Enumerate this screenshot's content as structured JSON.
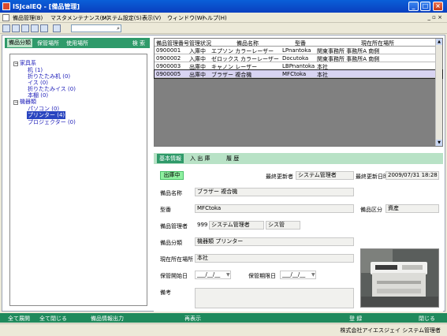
{
  "window": {
    "title": "ISJcalEQ - [備品管理]",
    "min": "_",
    "max": "□",
    "close": "×"
  },
  "menu": {
    "items": [
      "備品管理(B)",
      "マスタメンテナンス(M)",
      "システム設定(S)",
      "表示(V)",
      "ウィンドウ(W)",
      "ヘルプ(H)"
    ],
    "right": "_ ▫ ×"
  },
  "left_tabs": {
    "tabs": [
      "備品分類",
      "保管場所",
      "使用場所"
    ],
    "search": "検 索"
  },
  "tree": [
    {
      "label": "家具系",
      "box": "−"
    },
    {
      "label": "机 (1)"
    },
    {
      "label": "折りたたみ机 (0)"
    },
    {
      "label": "イス (0)"
    },
    {
      "label": "折りたたみイス (0)"
    },
    {
      "label": "本棚 (0)"
    },
    {
      "label": "機器類",
      "box": "−"
    },
    {
      "label": "パソコン (0)"
    },
    {
      "label": "プリンター (4)"
    },
    {
      "label": "プロジェクター (0)"
    }
  ],
  "grid": {
    "headers": [
      "備品管理番号",
      "管理状況",
      "備品名称",
      "型番",
      "現在所在場所"
    ],
    "rows": [
      [
        "0900001",
        "入庫中",
        "エプソン カラーレーザー",
        "LPnantoka",
        "関東事務所 事務所A 南側"
      ],
      [
        "0900002",
        "入庫中",
        "ゼロックス カラーレーザー",
        "Docutoka",
        "関東事務所 事務所A 南側"
      ],
      [
        "0900003",
        "出庫中",
        "キャノン レーザー",
        "LBPnantoka",
        "本社"
      ],
      [
        "0900005",
        "出庫中",
        "ブラザー 複合機",
        "MFCtoka",
        "本社"
      ]
    ]
  },
  "detail_tabs": [
    "基本情報",
    "入 出 庫",
    "履 歴"
  ],
  "detail": {
    "status": "出庫中",
    "last_updater_label": "最終更新者",
    "last_updater": "システム管理者",
    "last_updated_label": "最終更新日時",
    "last_updated": "2009/07/31 18:28",
    "name_label": "備品名称",
    "name": "ブラザー 複合機",
    "model_label": "型番",
    "model": "MFCtoka",
    "category_label": "備品区分",
    "category": "資産",
    "manager_label": "備品管理者",
    "manager_code": "999",
    "manager_name": "システム管理者",
    "manager_dept": "シス管",
    "class_label": "備品分類",
    "class": "機器類 プリンター",
    "location_label": "現在所在場所",
    "location": "本社",
    "start_label": "保管開始日",
    "start": "___/__/__",
    "end_label": "保管期限日",
    "end": "___/__/__",
    "notes_label": "備考",
    "notes": ""
  },
  "bottom": {
    "expand_all": "全て展開",
    "collapse_all": "全て閉じる",
    "export": "備品情報出力",
    "redisplay": "再表示",
    "register": "登 録",
    "close": "閉じる"
  },
  "statusbar": {
    "text": "株式会社アイエスジェイ システム管理者"
  }
}
